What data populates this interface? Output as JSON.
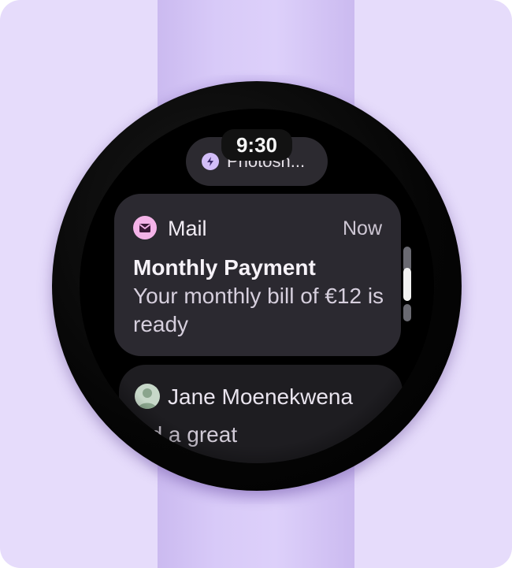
{
  "watch": {
    "time": "9:30",
    "status_chip": {
      "icon": "bolt-icon",
      "label": "Photosh..."
    }
  },
  "notifications": [
    {
      "app": "Mail",
      "app_icon": "mail-icon",
      "when": "Now",
      "title": "Monthly Payment",
      "body": "Your monthly bill of €12 is ready",
      "accent_color": "#f4b3e8"
    },
    {
      "sender": "Jane Moenekwena",
      "avatar_icon": "avatar",
      "preview": "ad a great"
    }
  ],
  "colors": {
    "background": "#e6dcfb",
    "strap": "#d8caf8",
    "card": "#2b2930",
    "chip_icon": "#d2bdf7"
  }
}
